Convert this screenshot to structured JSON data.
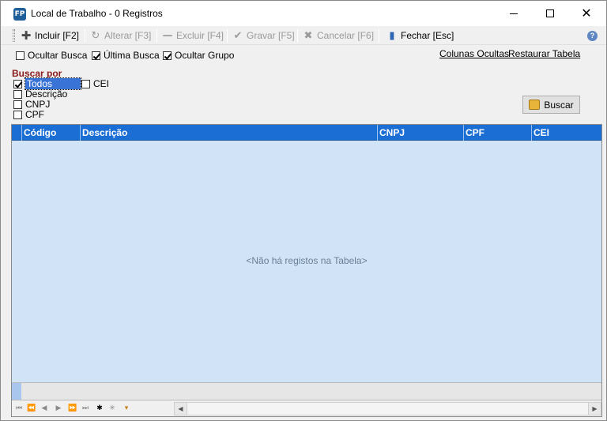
{
  "window": {
    "app_icon_text": "FP",
    "title": "Local de Trabalho - 0 Registros"
  },
  "toolbar": {
    "incluir": "Incluir [F2]",
    "alterar": "Alterar [F3]",
    "excluir": "Excluir [F4]",
    "gravar": "Gravar [F5]",
    "cancelar": "Cancelar [F6]",
    "fechar": "Fechar [Esc]",
    "help": "?"
  },
  "options": {
    "ocultar_busca": {
      "label": "Ocultar Busca",
      "checked": false
    },
    "ultima_busca": {
      "label": "Última Busca",
      "checked": true
    },
    "ocultar_grupo": {
      "label": "Ocultar Grupo",
      "checked": true
    },
    "colunas_ocultas": "Colunas Ocultas",
    "restaurar_tabela": "Restaurar Tabela"
  },
  "search": {
    "title": "Buscar por",
    "todos": {
      "label": "Todos",
      "checked": true
    },
    "cei": {
      "label": "CEI",
      "checked": false
    },
    "descricao": {
      "label": "Descrição",
      "checked": false
    },
    "cnpj": {
      "label": "CNPJ",
      "checked": false
    },
    "cpf": {
      "label": "CPF",
      "checked": false
    },
    "button": "Buscar"
  },
  "grid": {
    "columns": [
      "Código",
      "Descrição",
      "CNPJ",
      "CPF",
      "CEI"
    ],
    "rows": [],
    "empty_message": "<Não há registos na Tabela>"
  },
  "colors": {
    "header_bg": "#1b6ed4",
    "grid_bg": "#d1e3f7",
    "search_title": "#8b1a1a"
  }
}
